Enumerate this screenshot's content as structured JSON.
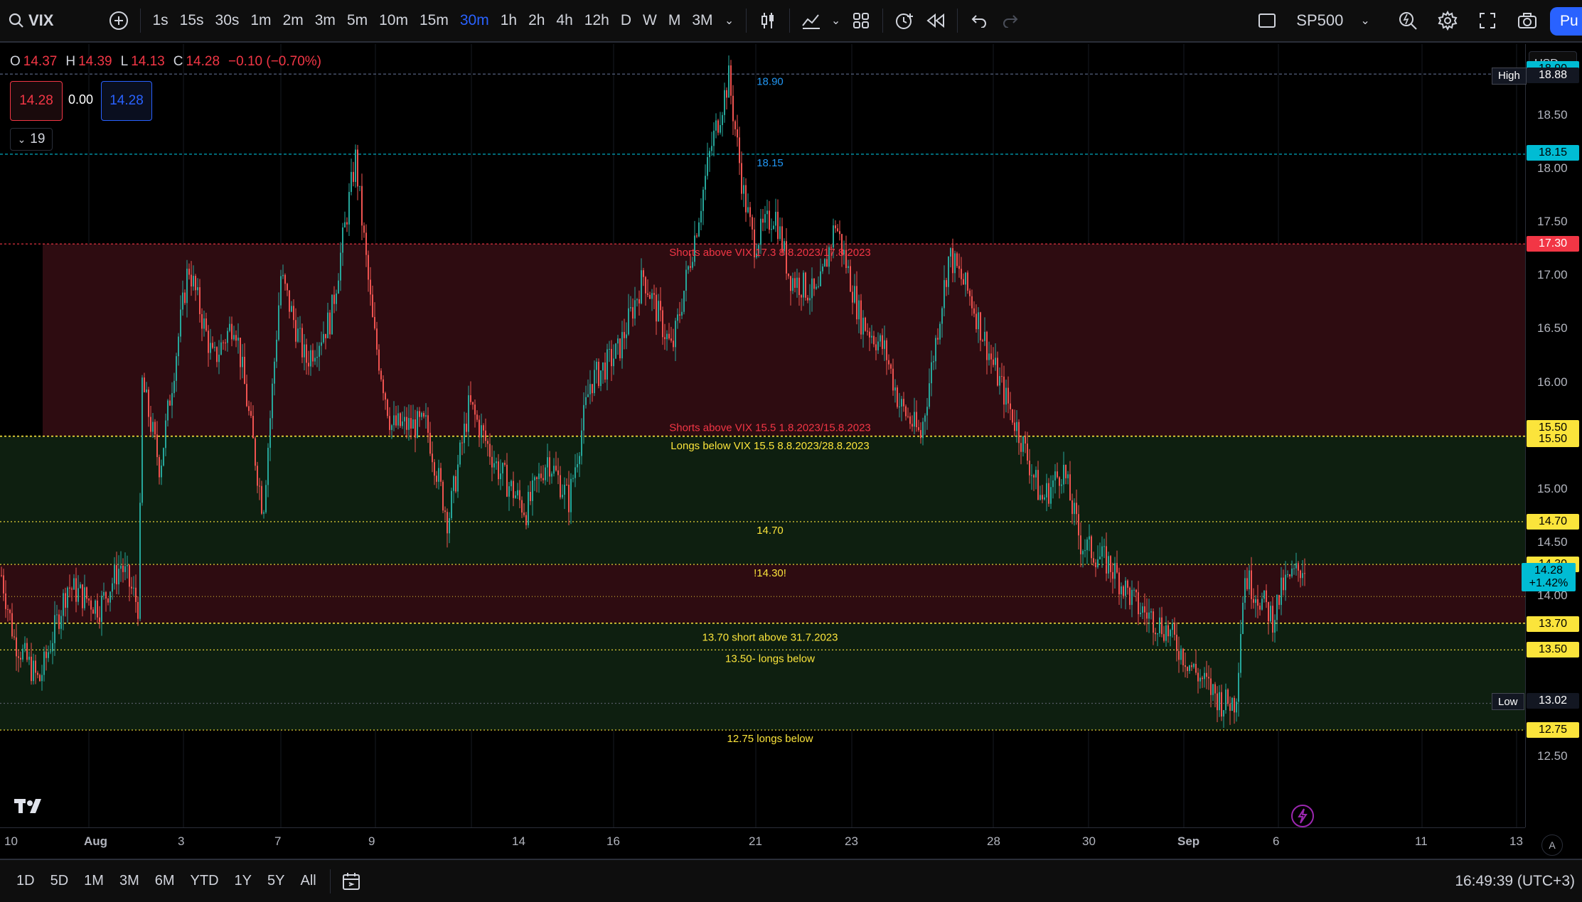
{
  "toolbar": {
    "symbol": "VIX",
    "timeframes": [
      "1s",
      "15s",
      "30s",
      "1m",
      "2m",
      "3m",
      "5m",
      "10m",
      "15m",
      "30m",
      "1h",
      "2h",
      "4h",
      "12h",
      "D",
      "W",
      "M",
      "3M"
    ],
    "active_timeframe": "30m",
    "compare_symbol": "SP500",
    "publish_label": "Pu"
  },
  "legend": {
    "o_label": "O",
    "o_value": "14.37",
    "h_label": "H",
    "h_value": "14.39",
    "l_label": "L",
    "l_value": "14.13",
    "c_label": "C",
    "c_value": "14.28",
    "change": "−0.10 (−0.70%)",
    "sell_price": "14.28",
    "spread": "0.00",
    "buy_price": "14.28",
    "indicators_count": "19"
  },
  "currency": "USD",
  "price_axis": {
    "ticks": [
      "18.50",
      "18.00",
      "17.50",
      "17.00",
      "16.50",
      "16.00",
      "15.00",
      "14.50",
      "14.00",
      "12.50"
    ],
    "tags": [
      {
        "value": "18.90",
        "bg": "#00bcd4",
        "fg": "#000"
      },
      {
        "value": "18.88",
        "bg": "#131722",
        "fg": "#fff",
        "label": "High"
      },
      {
        "value": "18.15",
        "bg": "#00bcd4",
        "fg": "#000"
      },
      {
        "value": "17.30",
        "bg": "#f23645",
        "fg": "#fff"
      },
      {
        "value": "15.50",
        "bg": "#fbe43b",
        "fg": "#000"
      },
      {
        "value": "15.50",
        "bg": "#fbe43b",
        "fg": "#000"
      },
      {
        "value": "14.70",
        "bg": "#fbe43b",
        "fg": "#000"
      },
      {
        "value": "14.30",
        "bg": "#fbe43b",
        "fg": "#000"
      },
      {
        "value": "13.70",
        "bg": "#fbe43b",
        "fg": "#000"
      },
      {
        "value": "13.50",
        "bg": "#fbe43b",
        "fg": "#000"
      },
      {
        "value": "13.02",
        "bg": "#131722",
        "fg": "#fff",
        "label": "Low"
      },
      {
        "value": "12.75",
        "bg": "#fbe43b",
        "fg": "#000"
      }
    ],
    "current_price": "14.28",
    "current_change": "+1.42%"
  },
  "time_axis": {
    "labels": [
      "10",
      "Aug",
      "3",
      "7",
      "9",
      "14",
      "16",
      "21",
      "23",
      "28",
      "30",
      "Sep",
      "6",
      "11",
      "13"
    ]
  },
  "annotations": {
    "top_line_label": "18.90",
    "second_line_label": "18.15",
    "short_zone_top_label": "Shorts above VIX 17.3 8.8.2023/17.8.2023",
    "short_zone_bottom_label": "Shorts above VIX 15.5 1.8.2023/15.8.2023",
    "long_zone_label": "Longs below VIX 15.5 8.8.2023/28.8.2023",
    "line_1470": "14.70",
    "line_1430": "!14.30!",
    "line_1370": "13.70 short above 31.7.2023",
    "line_1350": "13.50- longs below",
    "line_1275": "12.75 longs below"
  },
  "bottom_toolbar": {
    "ranges": [
      "1D",
      "5D",
      "1M",
      "3M",
      "6M",
      "YTD",
      "1Y",
      "5Y",
      "All"
    ],
    "clock": "16:49:39 (UTC+3)",
    "auto_label": "A"
  },
  "colors": {
    "up": "#26a69a",
    "down": "#ef5350",
    "short_zone": "#2e0c11",
    "long_zone": "#0e1f10",
    "accent": "#2962ff"
  }
}
